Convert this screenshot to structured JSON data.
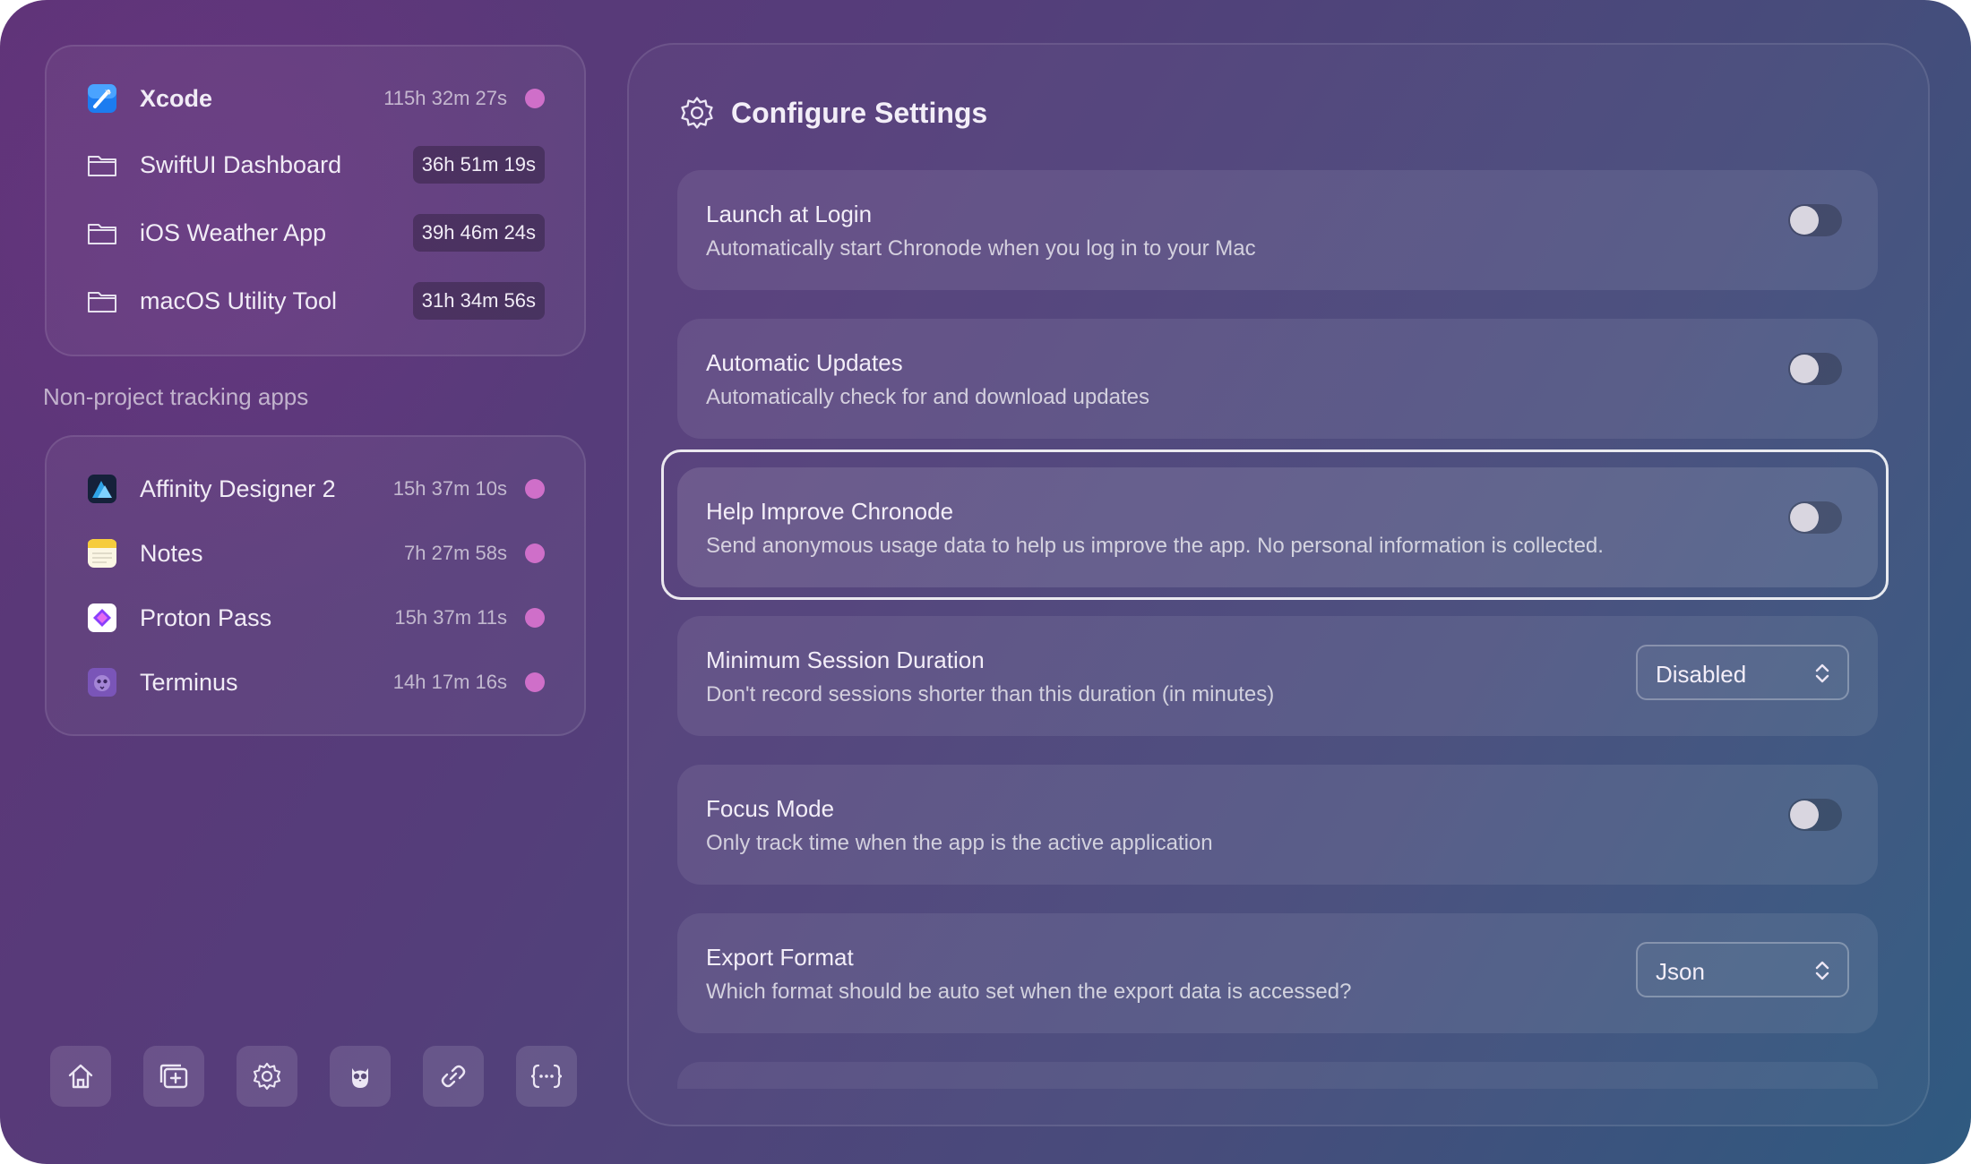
{
  "projects": [
    {
      "name": "Xcode",
      "time": "115h 32m 27s",
      "icon": "xcode-icon",
      "dot_color": "#cf6fc9"
    },
    {
      "name": "SwiftUI Dashboard",
      "time": "36h 51m 19s",
      "icon": "folder-icon"
    },
    {
      "name": "iOS Weather App",
      "time": "39h 46m 24s",
      "icon": "folder-icon"
    },
    {
      "name": "macOS Utility Tool",
      "time": "31h 34m 56s",
      "icon": "folder-icon"
    }
  ],
  "non_project_label": "Non-project tracking apps",
  "apps": [
    {
      "name": "Affinity Designer 2",
      "time": "15h 37m 10s",
      "icon": "affinity-designer-icon",
      "dot_color": "#cf6fc9"
    },
    {
      "name": "Notes",
      "time": "7h 27m 58s",
      "icon": "notes-icon",
      "dot_color": "#cf6fc9"
    },
    {
      "name": "Proton Pass",
      "time": "15h 37m 11s",
      "icon": "proton-pass-icon",
      "dot_color": "#cf6fc9"
    },
    {
      "name": "Terminus",
      "time": "14h 17m 16s",
      "icon": "terminus-icon",
      "dot_color": "#cf6fc9"
    }
  ],
  "toolbar": [
    "home-icon",
    "add-window-icon",
    "gear-icon",
    "owl-icon",
    "link-icon",
    "json-braces-icon"
  ],
  "settings": {
    "title": "Configure Settings",
    "items": [
      {
        "title": "Launch at Login",
        "desc": "Automatically start Chronode when you log in to your Mac",
        "control": "toggle",
        "on": false
      },
      {
        "title": "Automatic Updates",
        "desc": "Automatically check for and download updates",
        "control": "toggle",
        "on": false
      },
      {
        "title": "Help Improve Chronode",
        "desc": "Send anonymous usage data to help us improve the app. No personal information is collected.",
        "control": "toggle",
        "on": false
      },
      {
        "title": "Minimum Session Duration",
        "desc": "Don't record sessions shorter than this duration (in minutes)",
        "control": "select",
        "value": "Disabled"
      },
      {
        "title": "Focus Mode",
        "desc": "Only track time when the app is the active application",
        "control": "toggle",
        "on": false
      },
      {
        "title": "Export Format",
        "desc": "Which format should be auto set when the export data is accessed?",
        "control": "select",
        "value": "Json"
      }
    ]
  }
}
